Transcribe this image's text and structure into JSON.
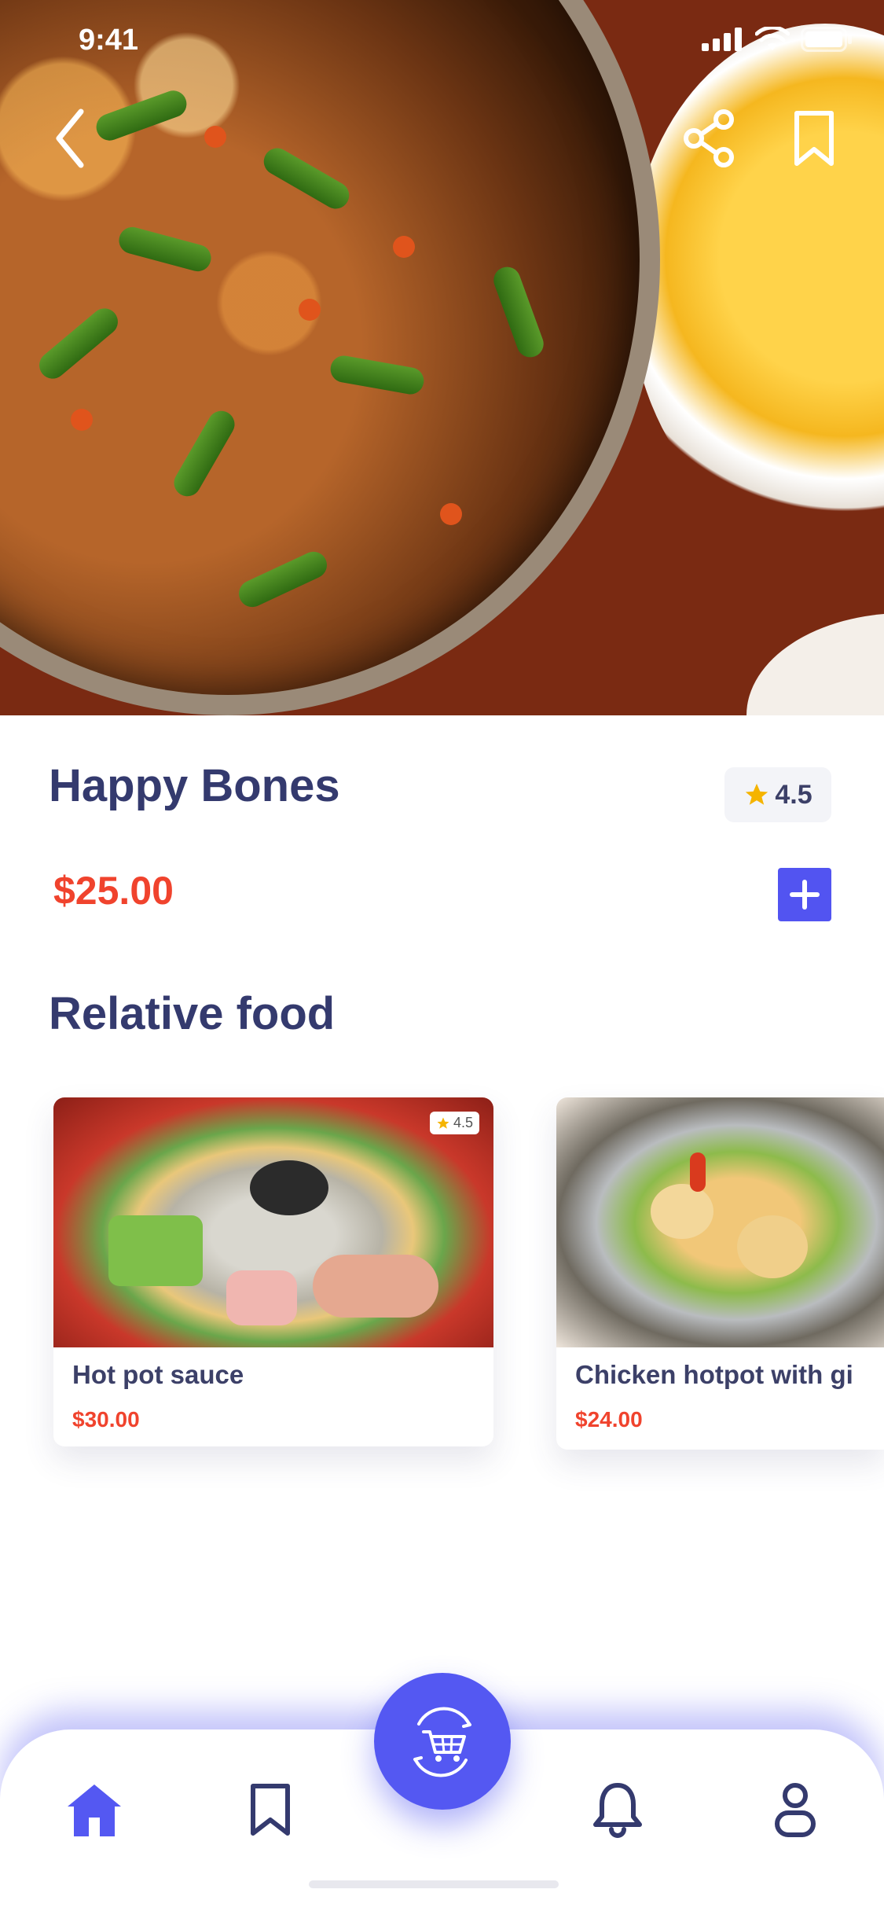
{
  "status_bar": {
    "time": "9:41"
  },
  "dish": {
    "title": "Happy Bones",
    "rating": "4.5",
    "price": "$25.00"
  },
  "section": {
    "title": "Relative food"
  },
  "related": [
    {
      "name": "Hot pot sauce",
      "price": "$30.00",
      "rating": "4.5"
    },
    {
      "name": "Chicken hotpot with gi",
      "price": "$24.00"
    }
  ],
  "icons": {
    "back": "chevron-left-icon",
    "share": "share-icon",
    "bookmark": "bookmark-icon",
    "add": "plus-icon",
    "cart": "cart-icon",
    "home": "home-icon",
    "notifications": "bell-icon",
    "profile": "user-icon"
  },
  "colors": {
    "accent": "#5458F2",
    "price": "#F0432D",
    "heading": "#343A6E",
    "star": "#F5B400"
  }
}
